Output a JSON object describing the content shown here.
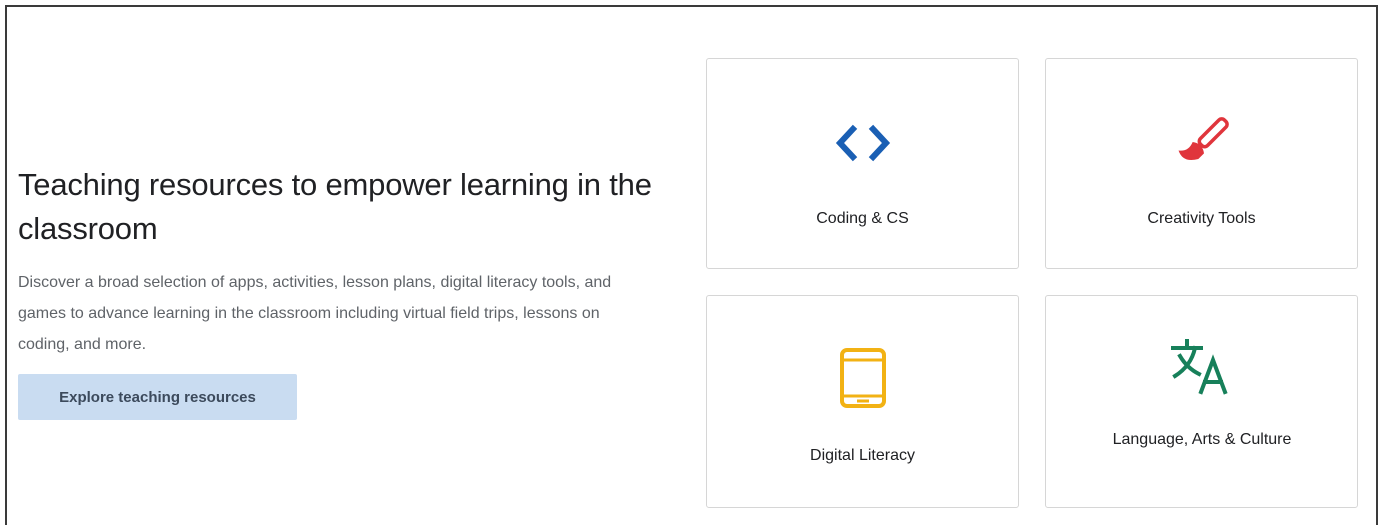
{
  "hero": {
    "title": "Teaching resources to empower learning in the classroom",
    "description": "Discover a broad selection of apps, activities, lesson plans, digital literacy tools, and games to advance learning in the classroom including virtual field trips, lessons on coding, and more.",
    "cta_label": "Explore teaching resources"
  },
  "cards": [
    {
      "label": "Coding & CS",
      "icon": "code-brackets-icon",
      "color": "#1a5fb4"
    },
    {
      "label": "Creativity Tools",
      "icon": "paintbrush-icon",
      "color": "#e0353c"
    },
    {
      "label": "Digital Literacy",
      "icon": "tablet-icon",
      "color": "#f2b214"
    },
    {
      "label": "Language, Arts & Culture",
      "icon": "translate-icon",
      "color": "#17805a"
    }
  ],
  "colors": {
    "cta_background": "#c9dcf1",
    "card_border": "#d6d6d6"
  }
}
